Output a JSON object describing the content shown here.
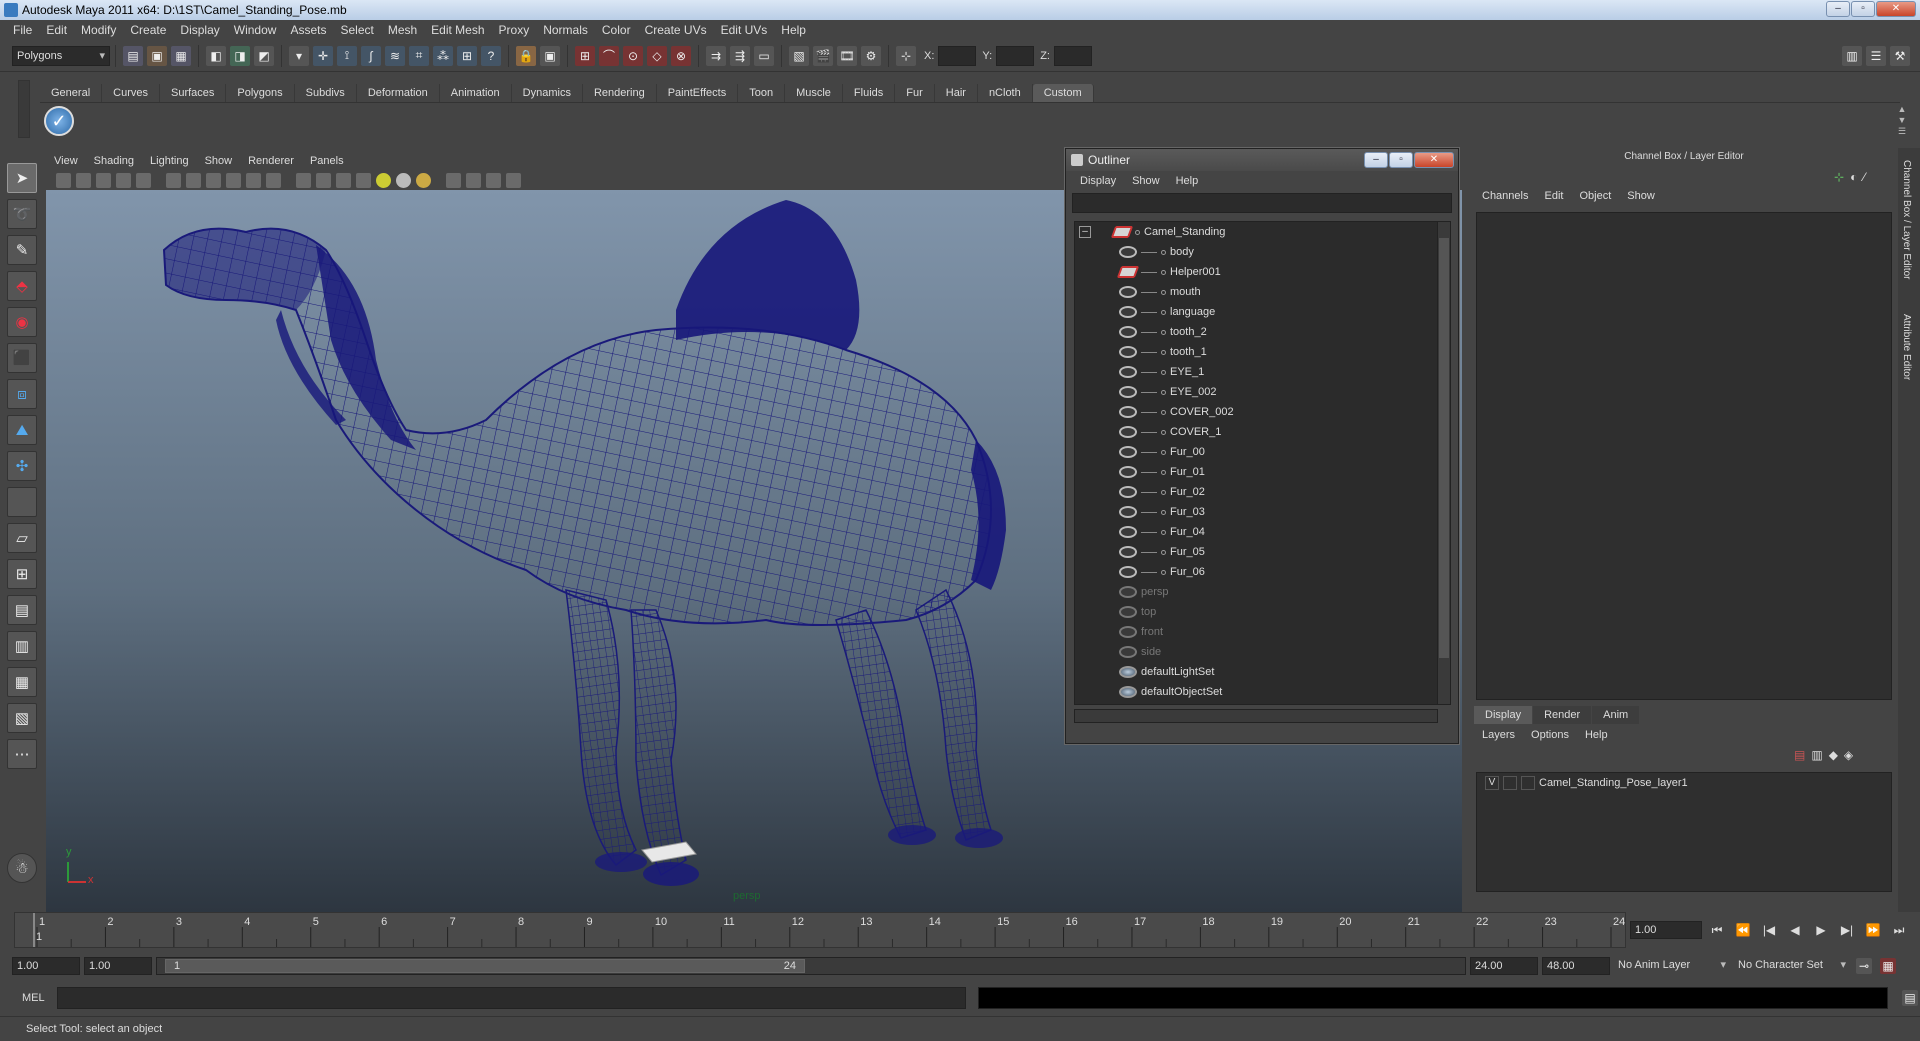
{
  "window": {
    "title": "Autodesk Maya 2011 x64: D:\\1ST\\Camel_Standing_Pose.mb"
  },
  "menubar": [
    "File",
    "Edit",
    "Modify",
    "Create",
    "Display",
    "Window",
    "Assets",
    "Select",
    "Mesh",
    "Edit Mesh",
    "Proxy",
    "Normals",
    "Color",
    "Create UVs",
    "Edit UVs",
    "Help"
  ],
  "statusline": {
    "menu_set": "Polygons",
    "x_label": "X:",
    "y_label": "Y:",
    "z_label": "Z:"
  },
  "shelf_tabs": [
    "General",
    "Curves",
    "Surfaces",
    "Polygons",
    "Subdivs",
    "Deformation",
    "Animation",
    "Dynamics",
    "Rendering",
    "PaintEffects",
    "Toon",
    "Muscle",
    "Fluids",
    "Fur",
    "Hair",
    "nCloth",
    "Custom"
  ],
  "shelf_active": "Custom",
  "viewport": {
    "menu": [
      "View",
      "Shading",
      "Lighting",
      "Show",
      "Renderer",
      "Panels"
    ],
    "camera_label": "persp",
    "axis": {
      "x": "x",
      "y": "y"
    }
  },
  "outliner": {
    "title": "Outliner",
    "menu": [
      "Display",
      "Show",
      "Help"
    ],
    "root": "Camel_Standing",
    "children": [
      "body",
      "Helper001",
      "mouth",
      "language",
      "tooth_2",
      "tooth_1",
      "EYE_1",
      "EYE_002",
      "COVER_002",
      "COVER_1",
      "Fur_00",
      "Fur_01",
      "Fur_02",
      "Fur_03",
      "Fur_04",
      "Fur_05",
      "Fur_06"
    ],
    "cameras": [
      "persp",
      "top",
      "front",
      "side"
    ],
    "sets": [
      "defaultLightSet",
      "defaultObjectSet"
    ]
  },
  "channel_box": {
    "title": "Channel Box / Layer Editor",
    "menu": [
      "Channels",
      "Edit",
      "Object",
      "Show"
    ],
    "layer_tabs": [
      "Display",
      "Render",
      "Anim"
    ],
    "layer_menu": [
      "Layers",
      "Options",
      "Help"
    ],
    "layer": {
      "visible": "V",
      "name": "Camel_Standing_Pose_layer1"
    },
    "side_tabs": [
      "Channel Box / Layer Editor",
      "Attribute Editor"
    ]
  },
  "timeline": {
    "ticks": [
      "1",
      "2",
      "3",
      "4",
      "5",
      "6",
      "7",
      "8",
      "9",
      "10",
      "11",
      "12",
      "13",
      "14",
      "15",
      "16",
      "17",
      "18",
      "19",
      "20",
      "21",
      "22",
      "23",
      "24"
    ],
    "current_frame": "1.00",
    "current_marker": "1"
  },
  "range": {
    "start_time": "1.00",
    "playback_start": "1.00",
    "slider_start": "1",
    "slider_end": "24",
    "playback_end": "24.00",
    "end_time": "48.00",
    "anim_layer": "No Anim Layer",
    "character_set": "No Character Set"
  },
  "command_line": {
    "label": "MEL"
  },
  "help_line": "Select Tool: select an object",
  "colors": {
    "wire": "#1a1a7a",
    "accent": "#3a7bbf"
  }
}
